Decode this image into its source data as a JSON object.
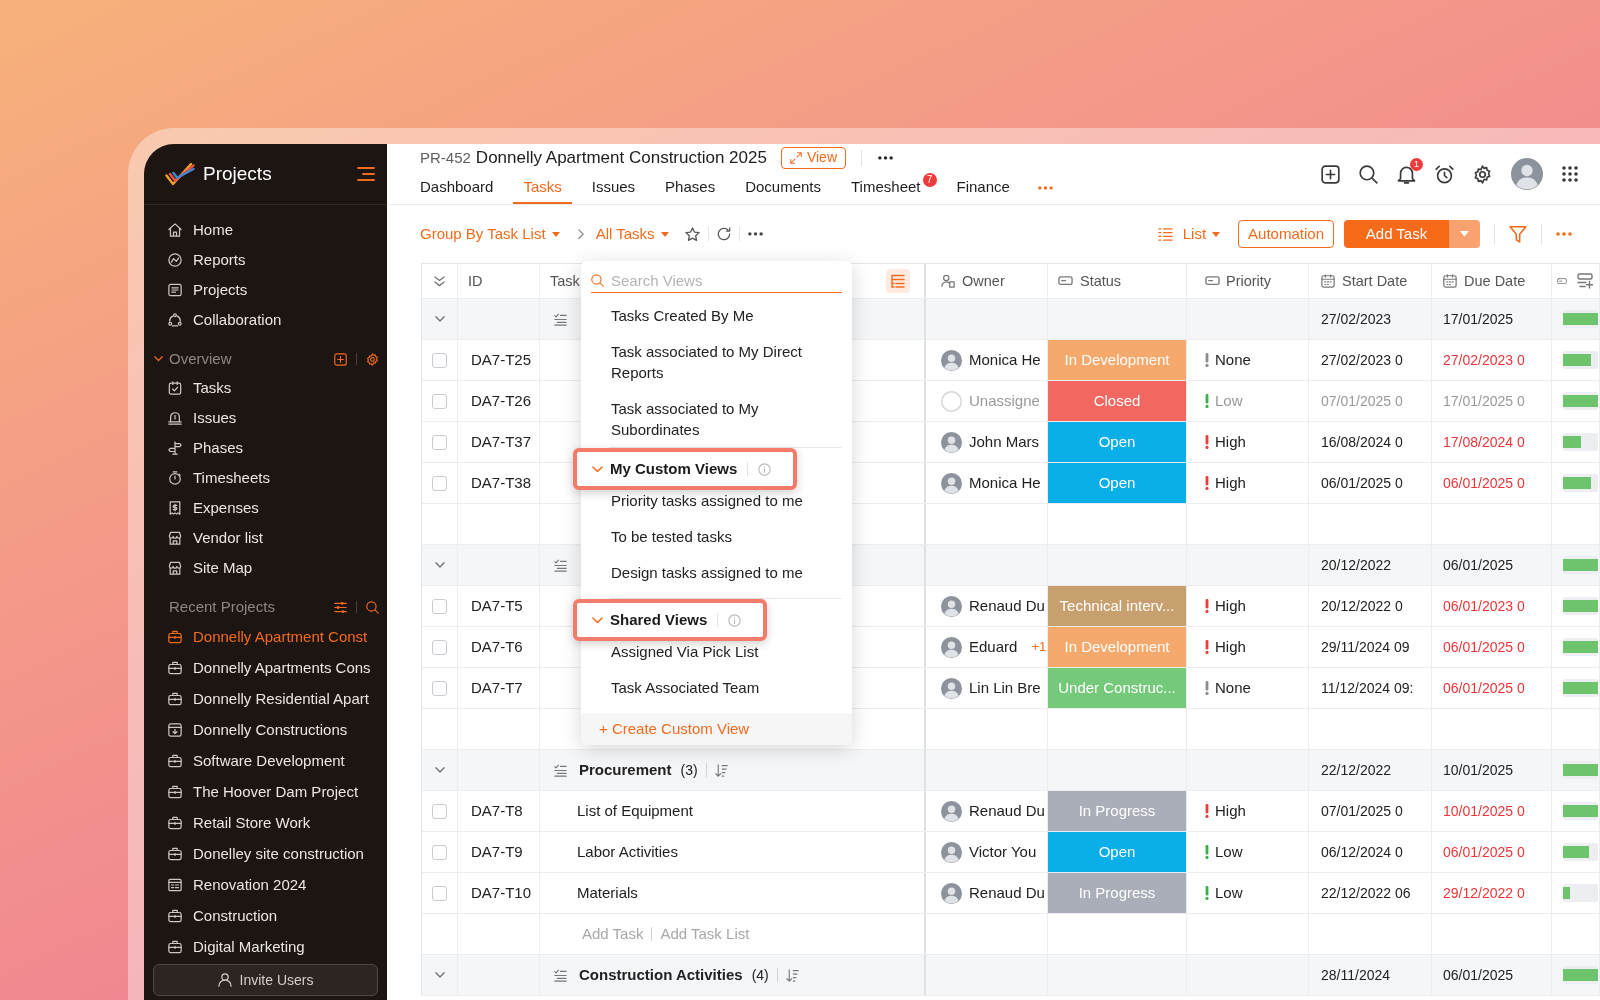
{
  "sidebar": {
    "app_name": "Projects",
    "nav": [
      "Home",
      "Reports",
      "Projects",
      "Collaboration"
    ],
    "overview": {
      "title": "Overview",
      "expanded": true,
      "items": [
        "Tasks",
        "Issues",
        "Phases",
        "Timesheets",
        "Expenses",
        "Vendor list",
        "Site Map"
      ]
    },
    "recent_projects": {
      "title": "Recent Projects",
      "items": [
        {
          "label": "Donnelly Apartment Const",
          "selected": true
        },
        {
          "label": "Donnelly Apartments Cons",
          "selected": false
        },
        {
          "label": "Donnelly Residential Apart",
          "selected": false
        },
        {
          "label": "Donnelly Constructions",
          "selected": false
        },
        {
          "label": "Software Development",
          "selected": false
        },
        {
          "label": "The Hoover Dam Project",
          "selected": false
        },
        {
          "label": "Retail Store Work",
          "selected": false
        },
        {
          "label": "Donelley site construction",
          "selected": false
        },
        {
          "label": "Renovation 2024",
          "selected": false
        },
        {
          "label": "Construction",
          "selected": false
        },
        {
          "label": "Digital Marketing",
          "selected": false
        }
      ]
    },
    "invite_button": "Invite Users"
  },
  "header": {
    "project_id": "PR-452",
    "project_name": "Donnelly Apartment Construction 2025",
    "view_button": "View",
    "tabs": [
      {
        "label": "Dashboard",
        "selected": false
      },
      {
        "label": "Tasks",
        "selected": true
      },
      {
        "label": "Issues",
        "selected": false
      },
      {
        "label": "Phases",
        "selected": false
      },
      {
        "label": "Documents",
        "selected": false
      },
      {
        "label": "Timesheet",
        "selected": false,
        "badge": "7"
      },
      {
        "label": "Finance",
        "selected": false
      }
    ],
    "notification_count": "1"
  },
  "toolbar": {
    "group_by": "Group By Task List",
    "view": "All Tasks",
    "layout": "List",
    "automation_button": "Automation",
    "add_button": "Add Task"
  },
  "view_menu": {
    "search_placeholder": "Search Views",
    "items": [
      "Tasks Created By Me",
      "Task associated to My Direct Reports",
      "Task associated to My Subordinates"
    ],
    "sections": [
      {
        "title": "My Custom Views",
        "expanded": true,
        "highlighted": true,
        "items": [
          "Priority tasks assigned to me",
          "To be tested tasks",
          "Design tasks assigned to me"
        ]
      },
      {
        "title": "Shared Views",
        "expanded": true,
        "highlighted": true,
        "items": [
          "Assigned Via Pick List",
          "Task Associated Team"
        ]
      }
    ],
    "create_link": "+ Create Custom View"
  },
  "table": {
    "columns": [
      "ID",
      "Task",
      "Owner",
      "Status",
      "Priority",
      "Start Date",
      "Due Date"
    ],
    "groups": [
      {
        "expanded": true,
        "start": "27/02/2023",
        "due": "17/01/2025",
        "level": 1,
        "rows": [
          {
            "id": "DA7-T25",
            "checked": false,
            "owner": {
              "name": "Monica He",
              "assigned": true
            },
            "status": {
              "label": "In Development",
              "color": "#f5a96c"
            },
            "priority": {
              "label": "None",
              "color": "#8c8c8c"
            },
            "start": "27/02/2023 0",
            "due": "27/02/2023 0",
            "overdue": true,
            "dimmed": false,
            "level": 0.8
          },
          {
            "id": "DA7-T26",
            "checked": false,
            "owner": {
              "name": "Unassigne",
              "assigned": false
            },
            "status": {
              "label": "Closed",
              "color": "#f2675f"
            },
            "priority": {
              "label": "Low",
              "color": "#3aae4a"
            },
            "start": "07/01/2025 0",
            "due": "17/01/2025 0",
            "overdue": false,
            "dimmed": true,
            "level": 1
          },
          {
            "id": "DA7-T37",
            "checked": false,
            "owner": {
              "name": "John Mars",
              "assigned": true
            },
            "status": {
              "label": "Open",
              "color": "#0aaee9"
            },
            "priority": {
              "label": "High",
              "color": "#e8413d"
            },
            "start": "16/08/2024 0",
            "due": "17/08/2024 0",
            "overdue": true,
            "dimmed": false,
            "level": 0.5
          },
          {
            "id": "DA7-T38",
            "checked": false,
            "owner": {
              "name": "Monica He",
              "assigned": true
            },
            "status": {
              "label": "Open",
              "color": "#0aaee9"
            },
            "priority": {
              "label": "High",
              "color": "#e8413d"
            },
            "start": "06/01/2025 0",
            "due": "06/01/2025 0",
            "overdue": true,
            "dimmed": false,
            "level": 0.8
          }
        ]
      },
      {
        "expanded": true,
        "start": "20/12/2022",
        "due": "06/01/2025",
        "level": 1,
        "rows": [
          {
            "id": "DA7-T5",
            "checked": false,
            "owner": {
              "name": "Renaud Du",
              "assigned": true
            },
            "status": {
              "label": "Technical interv...",
              "color": "#c8a06f"
            },
            "priority": {
              "label": "High",
              "color": "#e8413d"
            },
            "start": "20/12/2022 0",
            "due": "06/01/2023 0",
            "overdue": true,
            "dimmed": false,
            "level": 1
          },
          {
            "id": "DA7-T6",
            "checked": false,
            "owner": {
              "name": "Eduard",
              "assigned": true,
              "extra": "+1"
            },
            "status": {
              "label": "In Development",
              "color": "#f5a96c"
            },
            "priority": {
              "label": "High",
              "color": "#e8413d"
            },
            "start": "29/11/2024 09",
            "due": "06/01/2025 0",
            "overdue": true,
            "dimmed": false,
            "level": 1
          },
          {
            "id": "DA7-T7",
            "checked": false,
            "owner": {
              "name": "Lin Lin Bre",
              "assigned": true
            },
            "status": {
              "label": "Under Construc...",
              "color": "#74c97b"
            },
            "priority": {
              "label": "None",
              "color": "#8c8c8c"
            },
            "start": "11/12/2024 09:",
            "due": "06/01/2025 0",
            "overdue": true,
            "dimmed": false,
            "level": 1
          }
        ]
      },
      {
        "expanded": true,
        "name": "Procurement",
        "count": "(3)",
        "start": "22/12/2022",
        "due": "10/01/2025",
        "level": 1,
        "add_task": "Add Task",
        "add_task_list": "Add Task List",
        "rows": [
          {
            "id": "DA7-T8",
            "task": "List of Equipment",
            "checked": false,
            "owner": {
              "name": "Renaud Du",
              "assigned": true
            },
            "status": {
              "label": "In Progress",
              "color": "#a9aeb8"
            },
            "priority": {
              "label": "High",
              "color": "#e8413d"
            },
            "start": "07/01/2025 0",
            "due": "10/01/2025 0",
            "overdue": true,
            "dimmed": false,
            "level": 1
          },
          {
            "id": "DA7-T9",
            "task": "Labor Activities",
            "checked": false,
            "owner": {
              "name": "Victor You",
              "assigned": true
            },
            "status": {
              "label": "Open",
              "color": "#0aaee9"
            },
            "priority": {
              "label": "Low",
              "color": "#3aae4a"
            },
            "start": "06/12/2024 0",
            "due": "06/01/2025 0",
            "overdue": true,
            "dimmed": false,
            "level": 0.75
          },
          {
            "id": "DA7-T10",
            "task": "Materials",
            "checked": false,
            "owner": {
              "name": "Renaud Du",
              "assigned": true
            },
            "status": {
              "label": "In Progress",
              "color": "#a9aeb8"
            },
            "priority": {
              "label": "Low",
              "color": "#3aae4a"
            },
            "start": "22/12/2022 06",
            "due": "29/12/2022 0",
            "overdue": true,
            "dimmed": false,
            "level": 0.2
          }
        ]
      },
      {
        "expanded": true,
        "name": "Construction Activities",
        "count": "(4)",
        "start": "28/11/2024",
        "due": "06/01/2025",
        "level": 1
      }
    ]
  }
}
